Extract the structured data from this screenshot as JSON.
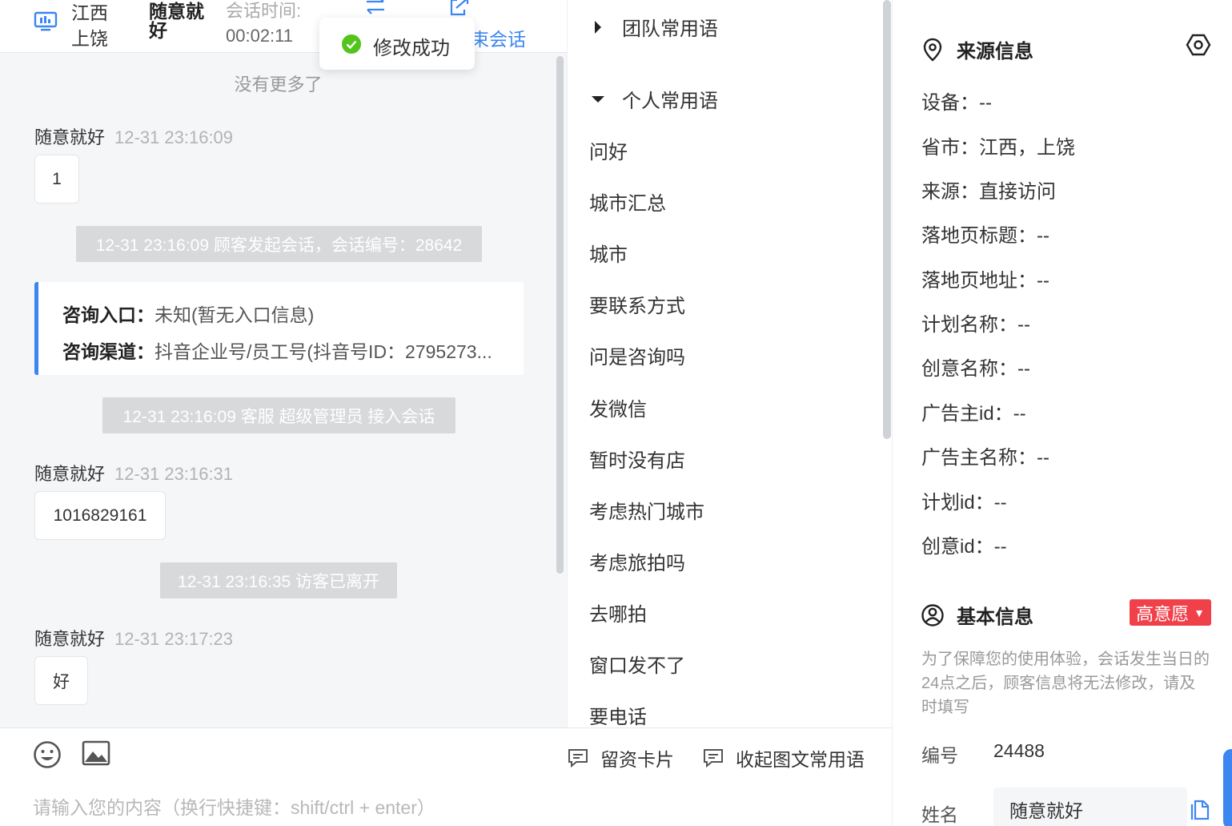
{
  "header": {
    "location": "江西上饶",
    "customer_name": "随意就好",
    "session_time_label": "会话时间:",
    "session_time": "00:02:11",
    "end_session_label": "束会话"
  },
  "toast": {
    "message": "修改成功"
  },
  "chat": {
    "no_more": "没有更多了",
    "messages": [
      {
        "sender": "随意就好",
        "time": "12-31 23:16:09",
        "text": "1"
      },
      {
        "sender": "随意就好",
        "time": "12-31 23:16:31",
        "text": "1016829161"
      },
      {
        "sender": "随意就好",
        "time": "12-31 23:17:23",
        "text": "好"
      }
    ],
    "system": [
      "12-31 23:16:09 顾客发起会话，会话编号：28642",
      "12-31 23:16:09 客服 超级管理员 接入会话",
      "12-31 23:16:35 访客已离开"
    ],
    "consult": {
      "entry_label": "咨询入口：",
      "entry_value": "未知(暂无入口信息)",
      "channel_label": "咨询渠道：",
      "channel_value": "抖音企业号/员工号(抖音号ID：2795273..."
    }
  },
  "input": {
    "card_label": "留资卡片",
    "collapse_label": "收起图文常用语",
    "placeholder": "请输入您的内容（换行快捷键：shift/ctrl + enter）"
  },
  "phrases": {
    "team_group": "团队常用语",
    "personal_group": "个人常用语",
    "items": [
      "问好",
      "城市汇总",
      "城市",
      "要联系方式",
      "问是咨询吗",
      "发微信",
      "暂时没有店",
      "考虑热门城市",
      "考虑旅拍吗",
      "去哪拍",
      "窗口发不了",
      "要电话"
    ]
  },
  "info": {
    "source_title": "来源信息",
    "source_fields": [
      "设备：--",
      "省市：江西，上饶",
      "来源：直接访问",
      "落地页标题：--",
      "落地页地址：--",
      "计划名称：--",
      "创意名称：--",
      "广告主id：--",
      "广告主名称：--",
      "计划id：--",
      "创意id：--"
    ],
    "basic_title": "基本信息",
    "intent_badge": "高意愿",
    "notice": "为了保障您的使用体验，会话发生当日的24点之后，顾客信息将无法修改，请及时填写",
    "id_label": "编号",
    "id_value": "24488",
    "name_label": "姓名",
    "name_value": "随意就好"
  },
  "colors": {
    "accent": "#3b86f0",
    "badge": "#f0404a",
    "success": "#52c41a"
  }
}
